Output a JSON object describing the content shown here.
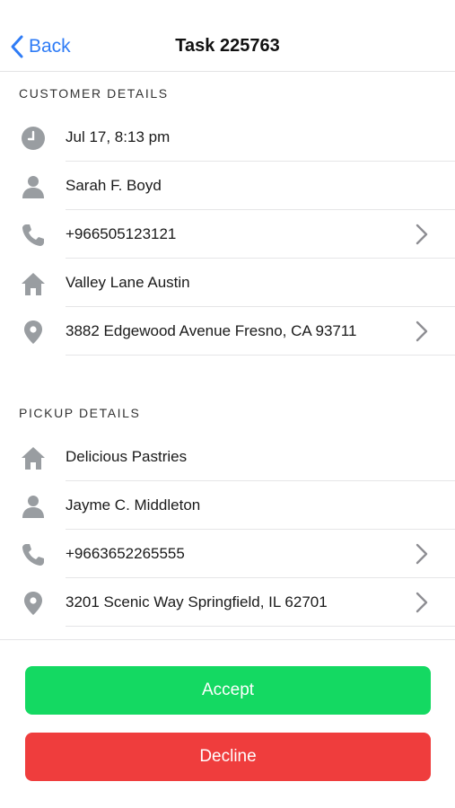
{
  "navbar": {
    "back_label": "Back",
    "title": "Task 225763"
  },
  "customer": {
    "header": "CUSTOMER DETAILS",
    "rows": [
      {
        "icon": "clock-icon",
        "label": "Jul 17, 8:13 pm",
        "chevron": false
      },
      {
        "icon": "person-icon",
        "label": "Sarah F. Boyd",
        "chevron": false
      },
      {
        "icon": "phone-icon",
        "label": "+966505123121",
        "chevron": true
      },
      {
        "icon": "home-icon",
        "label": "Valley Lane Austin",
        "chevron": false
      },
      {
        "icon": "location-pin-icon",
        "label": "3882 Edgewood Avenue Fresno, CA 93711",
        "chevron": true
      }
    ]
  },
  "pickup": {
    "header": "PICKUP DETAILS",
    "rows": [
      {
        "icon": "home-icon",
        "label": "Delicious Pastries",
        "chevron": false
      },
      {
        "icon": "person-icon",
        "label": "Jayme C. Middleton",
        "chevron": false
      },
      {
        "icon": "phone-icon",
        "label": "+9663652265555",
        "chevron": true
      },
      {
        "icon": "location-pin-icon",
        "label": "3201 Scenic Way Springfield, IL 62701",
        "chevron": true
      }
    ]
  },
  "actions": {
    "accept_label": "Accept",
    "decline_label": "Decline"
  },
  "colors": {
    "accent": "#2f7cf6",
    "accept": "#14d962",
    "decline": "#ef3d3d",
    "icon": "#999da1"
  }
}
